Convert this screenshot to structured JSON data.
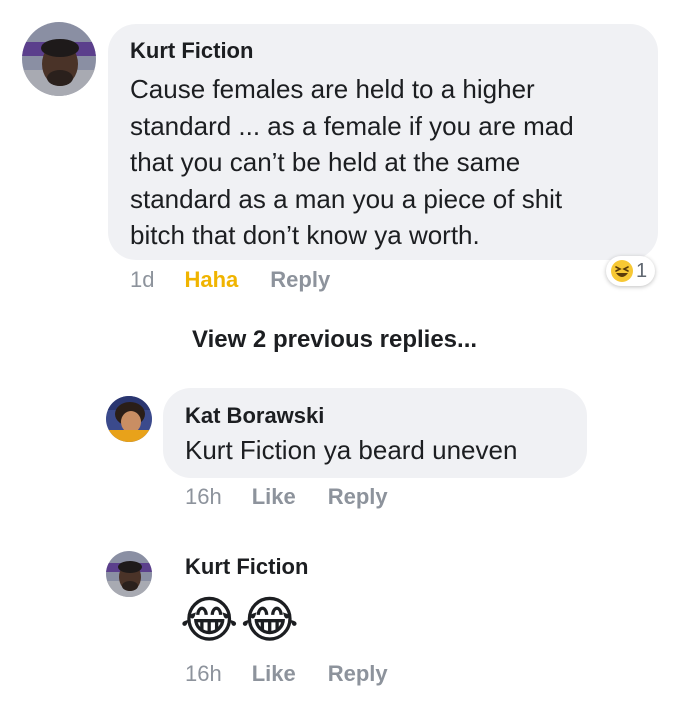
{
  "comments": [
    {
      "author": "Kurt Fiction",
      "text_lines": [
        "Cause females are held to a higher",
        "standard ... as a female if you are mad",
        "that you can’t be held at the same",
        "standard as a man you a piece of shit",
        "bitch that don’t know ya worth."
      ],
      "time": "1d",
      "reaction_label": "Haha",
      "reply_label": "Reply",
      "reaction_count": "1"
    }
  ],
  "view_previous": "View 2 previous replies...",
  "replies": [
    {
      "author": "Kat Borawski",
      "text": "Kurt Fiction ya beard uneven",
      "time": "16h",
      "like_label": "Like",
      "reply_label": "Reply"
    },
    {
      "author": "Kurt Fiction",
      "emojis": [
        "😂",
        "😂"
      ],
      "time": "16h",
      "like_label": "Like",
      "reply_label": "Reply"
    }
  ],
  "colors": {
    "bubble": "#f0f1f4",
    "meta": "#8d939c",
    "haha": "#f0b400"
  }
}
